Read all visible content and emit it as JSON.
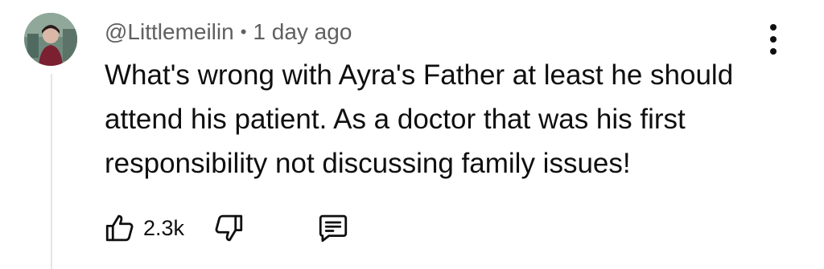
{
  "comment": {
    "username": "@Littlemeilin",
    "separator": "•",
    "timestamp": "1 day ago",
    "text_lines": [
      "What's wrong with Ayra's Father at least he should",
      "attend his patient. As a doctor that was his first",
      "responsibility not discussing family issues!"
    ],
    "like_count": "2.3k",
    "avatar": "avatar-image",
    "icons": {
      "like": "thumbs-up-icon",
      "dislike": "thumbs-down-icon",
      "reply": "reply-comment-icon",
      "more": "more-vertical-icon"
    }
  }
}
